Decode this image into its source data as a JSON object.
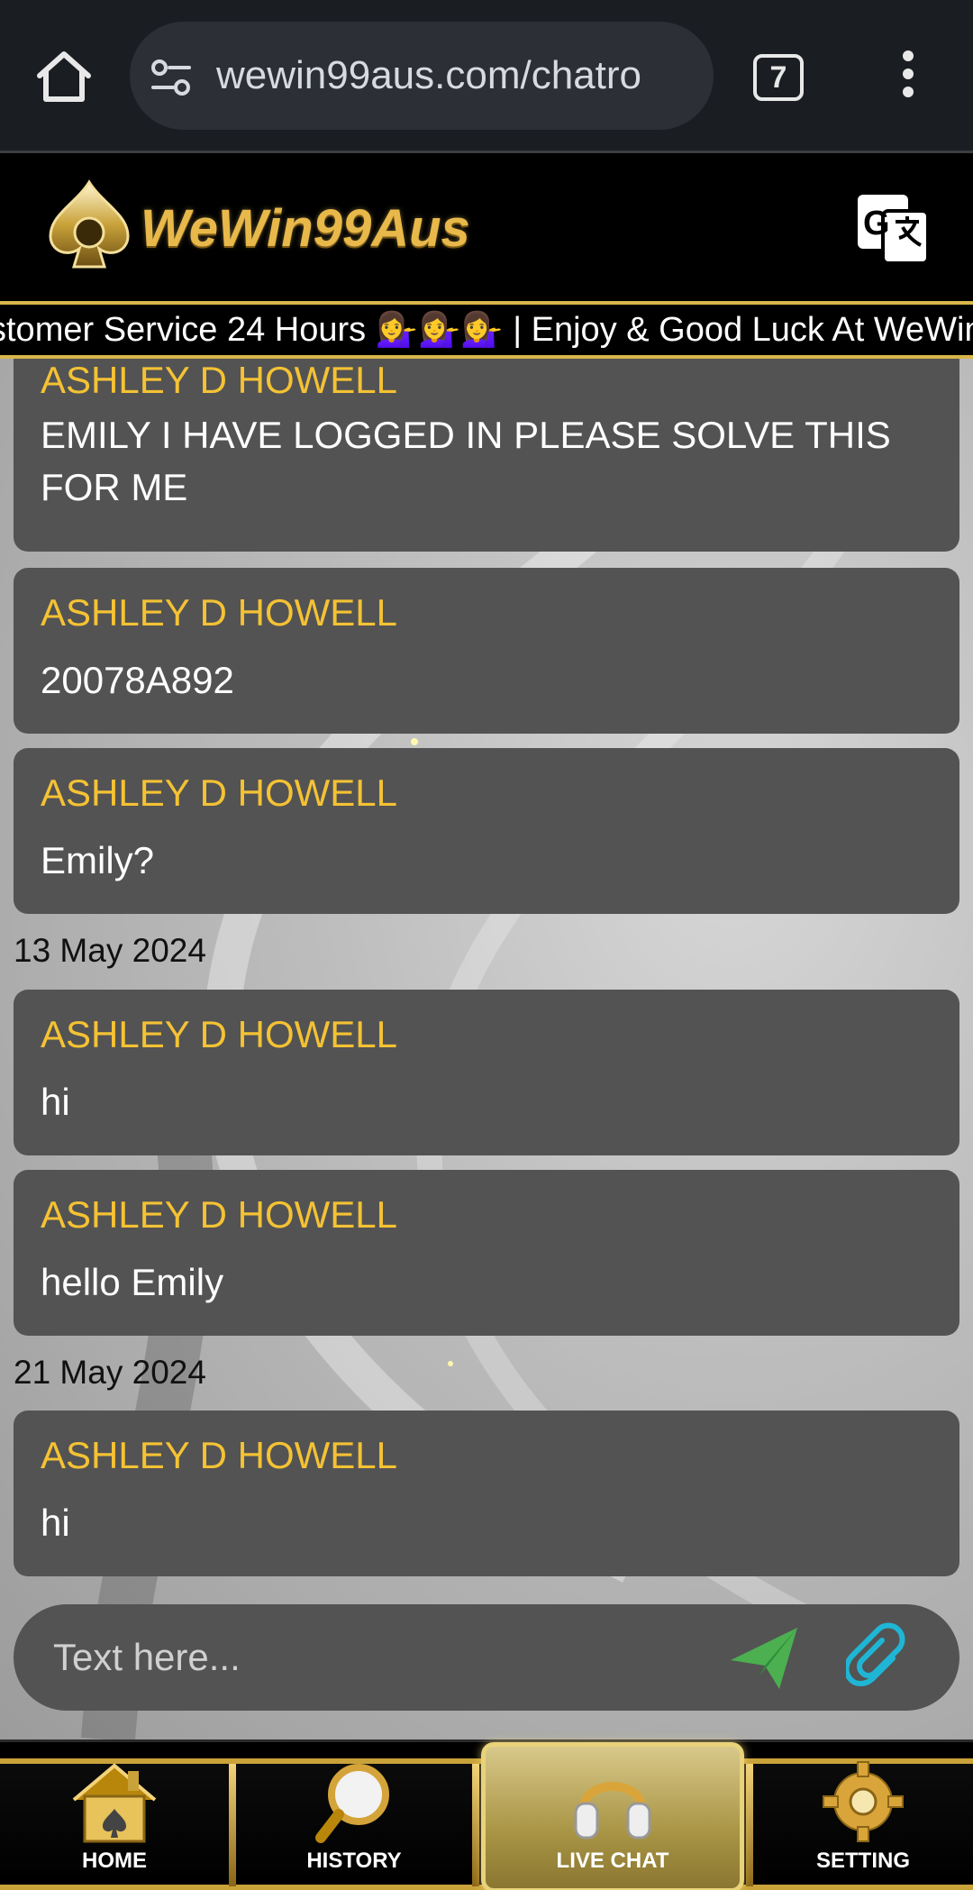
{
  "browser": {
    "url": "wewin99aus.com/chatro",
    "tab_count": "7"
  },
  "header": {
    "logo_text": "WeWin99Aus"
  },
  "marquee": {
    "text": "stomer Service 24 Hours 💁‍♀️💁‍♀️💁‍♀️ | Enjoy & Good Luck At WeWin"
  },
  "chat": {
    "messages": [
      {
        "sender": "ASHLEY D HOWELL",
        "text": "EMILY I HAVE LOGGED IN PLEASE SOLVE THIS FOR ME"
      },
      {
        "sender": "ASHLEY D HOWELL",
        "text": "20078A892"
      },
      {
        "sender": "ASHLEY D HOWELL",
        "text": "Emily?"
      },
      {
        "sender": "ASHLEY D HOWELL",
        "text": "hi"
      },
      {
        "sender": "ASHLEY D HOWELL",
        "text": "hello Emily"
      },
      {
        "sender": "ASHLEY D HOWELL",
        "text": "hi"
      }
    ],
    "dates": [
      "13 May 2024",
      "21 May 2024"
    ]
  },
  "composer": {
    "placeholder": "Text here..."
  },
  "nav": {
    "items": [
      {
        "label": "HOME"
      },
      {
        "label": "HISTORY"
      },
      {
        "label": "LIVE CHAT"
      },
      {
        "label": "SETTING"
      }
    ],
    "active": "LIVE CHAT"
  },
  "colors": {
    "accent_gold": "#f4c234",
    "bubble": "#535353",
    "send_green": "#4caf50",
    "attach_cyan": "#1fb6d6"
  }
}
